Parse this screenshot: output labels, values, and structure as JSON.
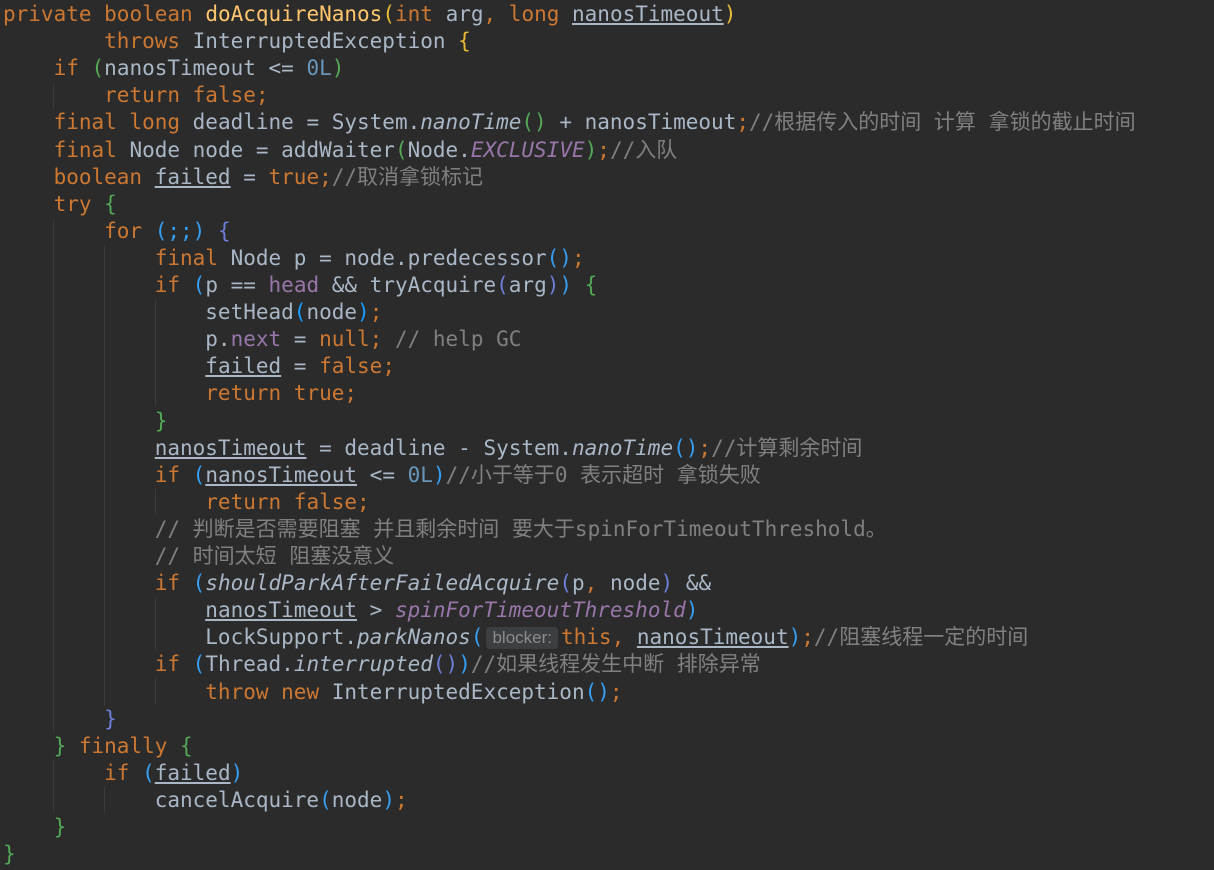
{
  "code": {
    "lines": [
      [
        [
          "private ",
          "kw"
        ],
        [
          "boolean ",
          "kw"
        ],
        [
          "doAcquireNanos",
          "fn"
        ],
        [
          "(",
          "b0"
        ],
        [
          "int ",
          "kw"
        ],
        [
          "arg",
          "tx"
        ],
        [
          ", ",
          "kw"
        ],
        [
          "long ",
          "kw"
        ],
        [
          "nanosTimeout",
          "tx ul"
        ],
        [
          ")",
          "b0"
        ]
      ],
      [
        [
          "        throws ",
          "kw"
        ],
        [
          "InterruptedException ",
          "tx"
        ],
        [
          "{",
          "b0"
        ]
      ],
      [
        [
          "    if ",
          "kw"
        ],
        [
          "(",
          "b1"
        ],
        [
          "nanosTimeout <= ",
          "tx"
        ],
        [
          "0L",
          "num"
        ],
        [
          ")",
          "b1"
        ]
      ],
      [
        [
          "        return ",
          "kw"
        ],
        [
          "false",
          "kw"
        ],
        [
          ";",
          "kw"
        ]
      ],
      [
        [
          "    final ",
          "kw"
        ],
        [
          "long ",
          "kw"
        ],
        [
          "deadline = System.",
          "tx"
        ],
        [
          "nanoTime",
          "it"
        ],
        [
          "()",
          "b1"
        ],
        [
          " + nanosTimeout",
          "tx"
        ],
        [
          ";",
          "kw"
        ],
        [
          "//根据传入的时间 计算 拿锁的截止时间",
          "cm"
        ]
      ],
      [
        [
          "    final ",
          "kw"
        ],
        [
          "Node node = addWaiter",
          "tx"
        ],
        [
          "(",
          "b1"
        ],
        [
          "Node.",
          "tx"
        ],
        [
          "EXCLUSIVE",
          "cst"
        ],
        [
          ")",
          "b1"
        ],
        [
          ";",
          "kw"
        ],
        [
          "//入队",
          "cm"
        ]
      ],
      [
        [
          "    boolean ",
          "kw"
        ],
        [
          "failed",
          "tx ul"
        ],
        [
          " = ",
          "tx"
        ],
        [
          "true",
          "kw"
        ],
        [
          ";",
          "kw"
        ],
        [
          "//取消拿锁标记",
          "cm"
        ]
      ],
      [
        [
          "    try ",
          "kw"
        ],
        [
          "{",
          "b1"
        ]
      ],
      [
        [
          "        for ",
          "kw"
        ],
        [
          "(;;) ",
          "b2"
        ],
        [
          "{",
          "b3"
        ]
      ],
      [
        [
          "            final ",
          "kw"
        ],
        [
          "Node p = node.predecessor",
          "tx"
        ],
        [
          "()",
          "b2"
        ],
        [
          ";",
          "kw"
        ]
      ],
      [
        [
          "            if ",
          "kw"
        ],
        [
          "(",
          "b2"
        ],
        [
          "p == ",
          "tx"
        ],
        [
          "head ",
          "fld"
        ],
        [
          "&& tryAcquire",
          "tx"
        ],
        [
          "(",
          "b3"
        ],
        [
          "arg",
          "tx"
        ],
        [
          ")",
          "b3"
        ],
        [
          ") ",
          "b2"
        ],
        [
          "{",
          "b1"
        ]
      ],
      [
        [
          "                setHead",
          "tx"
        ],
        [
          "(",
          "b4"
        ],
        [
          "node",
          "tx"
        ],
        [
          ")",
          "b4"
        ],
        [
          ";",
          "kw"
        ]
      ],
      [
        [
          "                p.",
          "tx"
        ],
        [
          "next ",
          "fld"
        ],
        [
          "= ",
          "tx"
        ],
        [
          "null",
          "kw"
        ],
        [
          "; ",
          "kw"
        ],
        [
          "// help GC",
          "cm"
        ]
      ],
      [
        [
          "                ",
          "tx"
        ],
        [
          "failed",
          "tx ul"
        ],
        [
          " = ",
          "tx"
        ],
        [
          "false",
          "kw"
        ],
        [
          ";",
          "kw"
        ]
      ],
      [
        [
          "                return ",
          "kw"
        ],
        [
          "true",
          "kw"
        ],
        [
          ";",
          "kw"
        ]
      ],
      [
        [
          "            }",
          "b1"
        ]
      ],
      [
        [
          "            ",
          "tx"
        ],
        [
          "nanosTimeout",
          "tx ul"
        ],
        [
          " = deadline - System.",
          "tx"
        ],
        [
          "nanoTime",
          "it"
        ],
        [
          "()",
          "b2"
        ],
        [
          ";",
          "kw"
        ],
        [
          "//计算剩余时间",
          "cm"
        ]
      ],
      [
        [
          "            if ",
          "kw"
        ],
        [
          "(",
          "b2"
        ],
        [
          "nanosTimeout",
          "tx ul"
        ],
        [
          " <= ",
          "tx"
        ],
        [
          "0L",
          "num"
        ],
        [
          ")",
          "b2"
        ],
        [
          "//小于等于0 表示超时 拿锁失败",
          "cm"
        ]
      ],
      [
        [
          "                return ",
          "kw"
        ],
        [
          "false",
          "kw"
        ],
        [
          ";",
          "kw"
        ]
      ],
      [
        [
          "            // 判断是否需要阻塞 并且剩余时间 要大于spinForTimeoutThreshold。",
          "cm"
        ]
      ],
      [
        [
          "            // 时间太短 阻塞没意义",
          "cm"
        ]
      ],
      [
        [
          "            if ",
          "kw"
        ],
        [
          "(",
          "b2"
        ],
        [
          "shouldParkAfterFailedAcquire",
          "it"
        ],
        [
          "(",
          "b3"
        ],
        [
          "p",
          "tx"
        ],
        [
          ", ",
          "kw"
        ],
        [
          "node",
          "tx"
        ],
        [
          ") ",
          "b3"
        ],
        [
          "&&",
          "tx"
        ]
      ],
      [
        [
          "                ",
          "tx"
        ],
        [
          "nanosTimeout",
          "tx ul"
        ],
        [
          " > ",
          "tx"
        ],
        [
          "spinForTimeoutThreshold",
          "cst"
        ],
        [
          ")",
          "b2"
        ]
      ],
      [
        [
          "                LockSupport.",
          "tx"
        ],
        [
          "parkNanos",
          "it"
        ],
        [
          "(",
          "b2"
        ],
        [
          "blocker:",
          "hint"
        ],
        [
          "this",
          "kw"
        ],
        [
          ", ",
          "kw"
        ],
        [
          "nanosTimeout",
          "tx ul"
        ],
        [
          ")",
          "b2"
        ],
        [
          ";",
          "kw"
        ],
        [
          "//阻塞线程一定的时间",
          "cm"
        ]
      ],
      [
        [
          "            if ",
          "kw"
        ],
        [
          "(",
          "b2"
        ],
        [
          "Thread.",
          "tx"
        ],
        [
          "interrupted",
          "it"
        ],
        [
          "()",
          "b3"
        ],
        [
          ")",
          "b2"
        ],
        [
          "//如果线程发生中断 排除异常",
          "cm"
        ]
      ],
      [
        [
          "                throw ",
          "kw"
        ],
        [
          "new ",
          "kw"
        ],
        [
          "InterruptedException",
          "tx"
        ],
        [
          "()",
          "b2"
        ],
        [
          ";",
          "kw"
        ]
      ],
      [
        [
          "        }",
          "b3"
        ]
      ],
      [
        [
          "    } ",
          "b1"
        ],
        [
          "finally ",
          "kw"
        ],
        [
          "{",
          "b1"
        ]
      ],
      [
        [
          "        if ",
          "kw"
        ],
        [
          "(",
          "b2"
        ],
        [
          "failed",
          "tx ul"
        ],
        [
          ")",
          "b2"
        ]
      ],
      [
        [
          "            cancelAcquire",
          "tx"
        ],
        [
          "(",
          "b2"
        ],
        [
          "node",
          "tx"
        ],
        [
          ")",
          "b2"
        ],
        [
          ";",
          "kw"
        ]
      ],
      [
        [
          "    }",
          "b1"
        ]
      ],
      [
        [
          "}",
          "b1"
        ]
      ]
    ]
  }
}
